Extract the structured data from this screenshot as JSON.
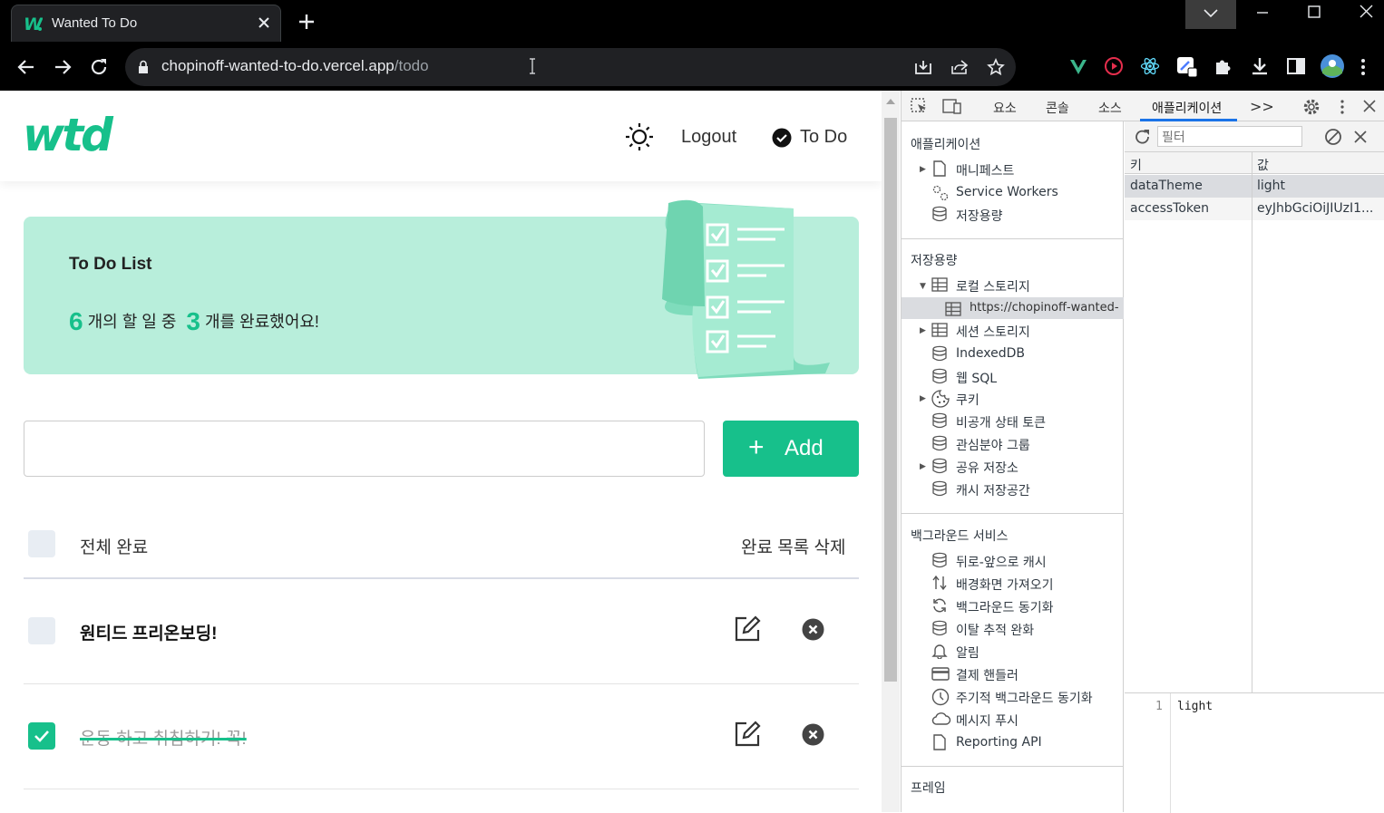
{
  "browser": {
    "tab_title": "Wanted To Do",
    "url_host": "chopinoff-wanted-to-do.vercel.app",
    "url_path": "/todo"
  },
  "app": {
    "logo": "wtd",
    "logout_label": "Logout",
    "nav_todo_label": "To Do",
    "banner_title": "To Do List",
    "total_count": "6",
    "stats_middle": "개의 할 일 중",
    "done_count": "3",
    "stats_end": "개를 완료했어요!",
    "input_value": "",
    "add_label": "Add",
    "complete_all_label": "전체 완료",
    "delete_completed_label": "완료 목록 삭제",
    "todos": [
      {
        "text": "원티드 프리온보딩!",
        "done": false
      },
      {
        "text": "운동 하고 취침하기! 꼭!",
        "done": true
      }
    ]
  },
  "devtools": {
    "tabs": [
      "요소",
      "콘솔",
      "소스",
      "애플리케이션"
    ],
    "more": ">>",
    "sections": {
      "application": "애플리케이션",
      "storage": "저장용량",
      "background": "백그라운드 서비스",
      "frames": "프레임"
    },
    "app_items": [
      "매니페스트",
      "Service Workers",
      "저장용량"
    ],
    "storage_items": {
      "local_storage": "로컬 스토리지",
      "local_origin": "https://chopinoff-wanted-",
      "session_storage": "세션 스토리지",
      "indexeddb": "IndexedDB",
      "websql": "웹 SQL",
      "cookies": "쿠키",
      "private_state": "비공개 상태 토큰",
      "interest_groups": "관심분야 그룹",
      "shared_storage": "공유 저장소",
      "cache_storage": "캐시 저장공간"
    },
    "background_items": [
      "뒤로-앞으로 캐시",
      "배경화면 가져오기",
      "백그라운드 동기화",
      "이탈 추적 완화",
      "알림",
      "결제 핸들러",
      "주기적 백그라운드 동기화",
      "메시지 푸시",
      "Reporting API"
    ],
    "filter_placeholder": "필터",
    "columns": {
      "key": "키",
      "value": "값"
    },
    "rows": [
      {
        "key": "dataTheme",
        "value": "light"
      },
      {
        "key": "accessToken",
        "value": "eyJhbGciOiJIUzI1..."
      }
    ],
    "preview_line": "1",
    "preview_value": "light"
  },
  "colors": {
    "accent": "#17c08b",
    "banner": "#b8eedb"
  }
}
